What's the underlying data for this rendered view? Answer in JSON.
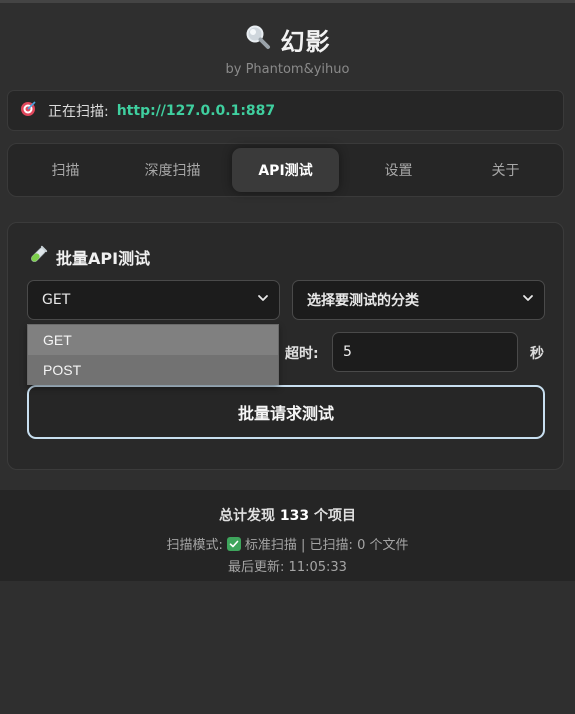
{
  "header": {
    "title": "幻影",
    "subtitle": "by Phantom&yihuo"
  },
  "scan": {
    "label": "正在扫描:",
    "url": "http://127.0.0.1:887"
  },
  "tabs": [
    {
      "label": "扫描",
      "active": false
    },
    {
      "label": "深度扫描",
      "active": false
    },
    {
      "label": "API测试",
      "active": true
    },
    {
      "label": "设置",
      "active": false
    },
    {
      "label": "关于",
      "active": false
    }
  ],
  "panel": {
    "title": "批量API测试",
    "method_select": {
      "value": "GET",
      "options": [
        "GET",
        "POST"
      ]
    },
    "category_select": {
      "value": "选择要测试的分类"
    },
    "timeout_label": "超时:",
    "timeout_value": "5",
    "timeout_unit": "秒",
    "run_button": "批量请求测试"
  },
  "footer": {
    "total_prefix": "总计发现",
    "total_count": "133",
    "total_suffix": "个项目",
    "mode_label": "扫描模式:",
    "mode_text": "标准扫描 | 已扫描: 0 个文件",
    "updated": "最后更新: 11:05:33"
  },
  "colors": {
    "accent_url": "#3fcf9f",
    "button_border": "#c8dff0",
    "check_green": "#3ea55c"
  }
}
